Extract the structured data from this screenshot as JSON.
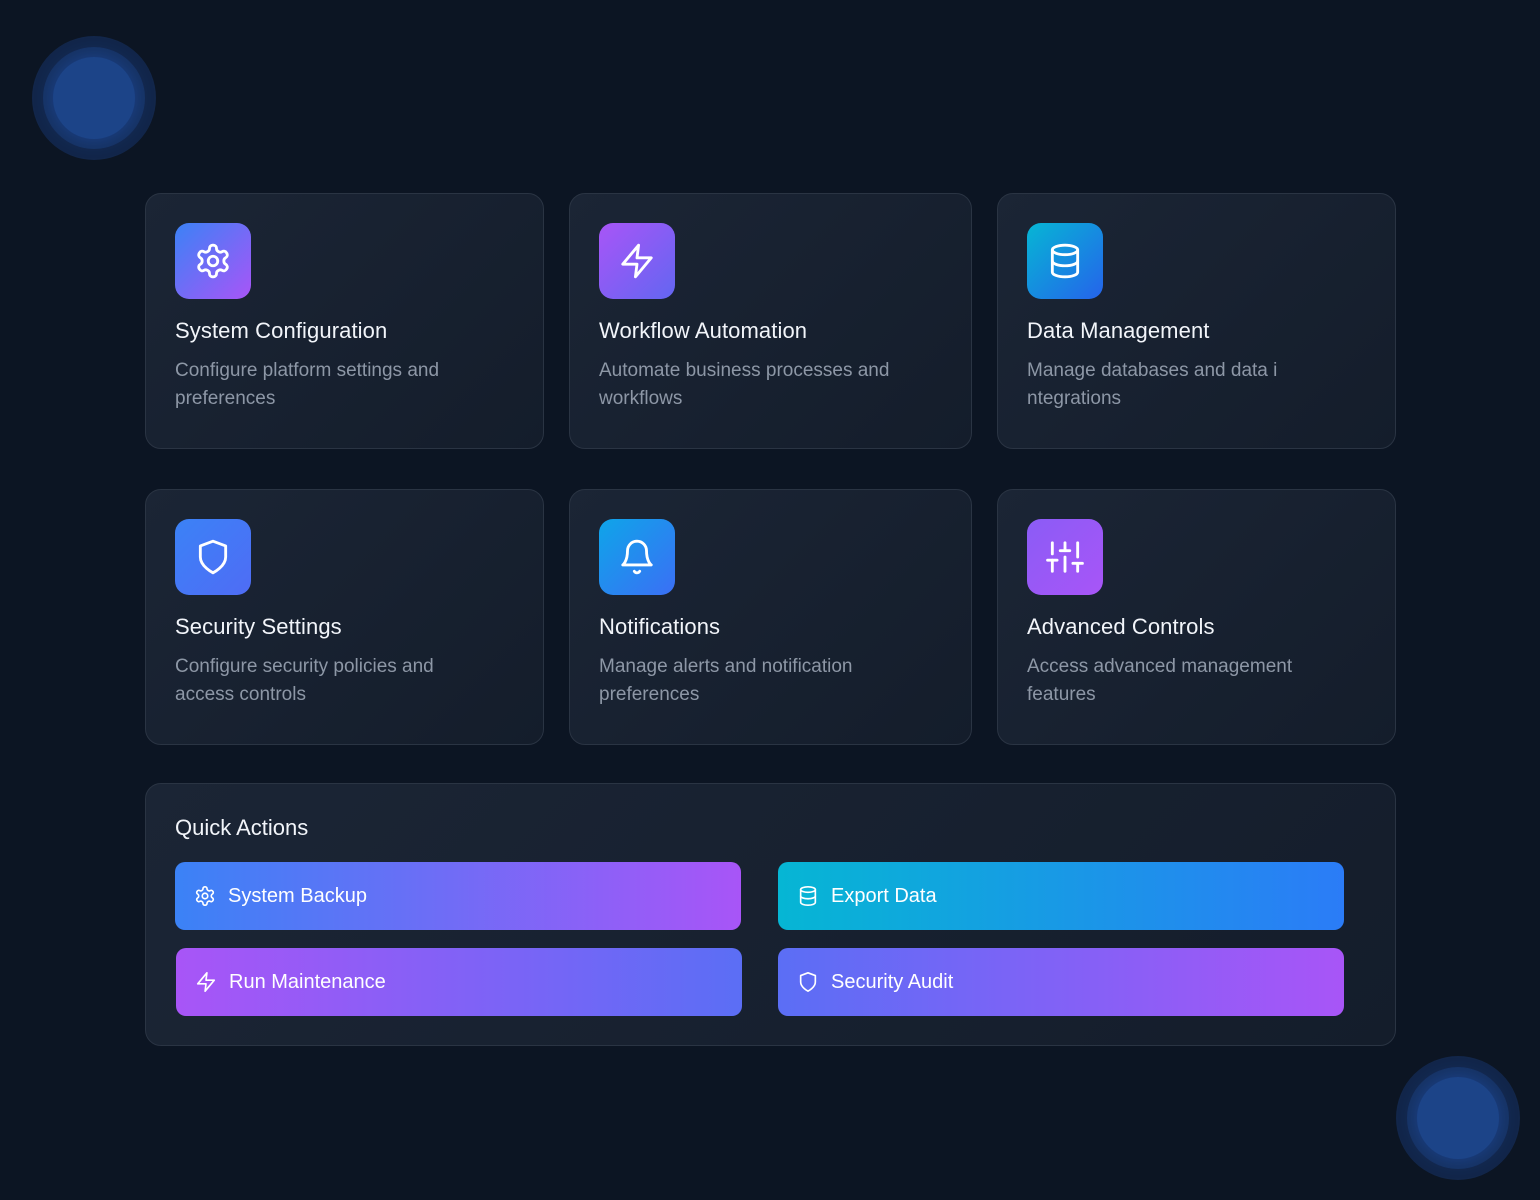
{
  "cards": [
    {
      "title": "System Configuration",
      "description": "Configure platform settings and preferences",
      "icon": "gear-icon"
    },
    {
      "title": "Workflow Automation",
      "description": "Automate business processes and workflows",
      "icon": "lightning-icon"
    },
    {
      "title": "Data Management",
      "description": "Manage databases and data i ntegrations",
      "icon": "database-icon"
    },
    {
      "title": "Security Settings",
      "description": "Configure security policies and access controls",
      "icon": "shield-icon"
    },
    {
      "title": "Notifications",
      "description": "Manage alerts and notification preferences",
      "icon": "bell-icon"
    },
    {
      "title": "Advanced Controls",
      "description": "Access advanced management features",
      "icon": "sliders-icon"
    }
  ],
  "quick_actions": {
    "title": "Quick Actions",
    "buttons": [
      {
        "label": "System Backup",
        "icon": "gear-icon"
      },
      {
        "label": "Export Data",
        "icon": "database-icon"
      },
      {
        "label": "Run Maintenance",
        "icon": "lightning-icon"
      },
      {
        "label": "Security Audit",
        "icon": "shield-icon"
      }
    ]
  },
  "colors": {
    "background": "#0c1523",
    "card": "#1b2535",
    "border": "#2a3443",
    "title_text": "#f2f5fa",
    "desc_text": "#8d97a6",
    "blue": "#3b82f6",
    "purple": "#a855f7",
    "cyan": "#06b6d4"
  }
}
